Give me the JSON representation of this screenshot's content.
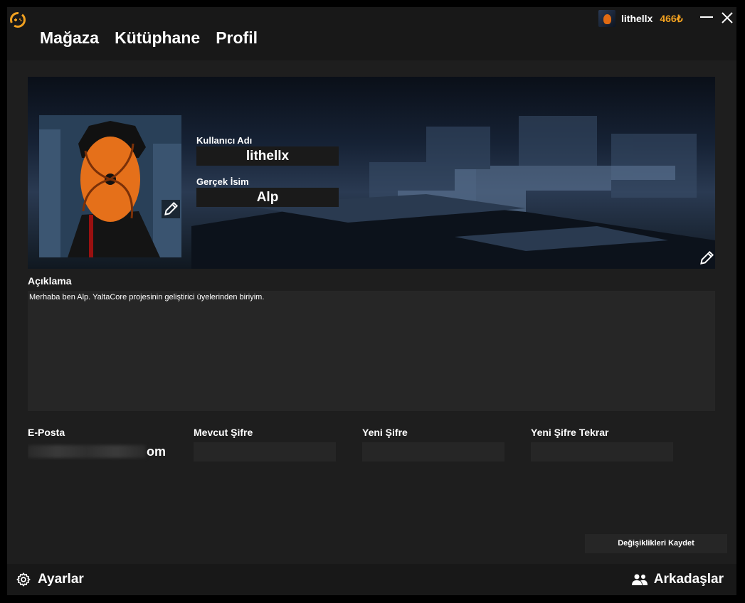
{
  "nav": {
    "items": [
      {
        "label": "Mağaza"
      },
      {
        "label": "Kütüphane"
      },
      {
        "label": "Profil"
      }
    ]
  },
  "user": {
    "name": "lithellx",
    "balance": "466₺"
  },
  "profile": {
    "username_label": "Kullanıcı Adı",
    "username_value": "lithellx",
    "realname_label": "Gerçek İsim",
    "realname_value": "Alp",
    "description_label": "Açıklama",
    "description_value": "Merhaba ben Alp. YaltaCore projesinin geliştirici üyelerinden biriyim."
  },
  "account": {
    "email_label": "E-Posta",
    "email_visible_suffix": "om",
    "current_password_label": "Mevcut Şifre",
    "new_password_label": "Yeni Şifre",
    "new_password_repeat_label": "Yeni Şifre Tekrar"
  },
  "actions": {
    "save_label": "Değişiklikleri Kaydet"
  },
  "footer": {
    "settings_label": "Ayarlar",
    "friends_label": "Arkadaşlar"
  },
  "colors": {
    "accent": "#f0a020",
    "window_bg": "#1e1e1e",
    "bar_bg": "#181818",
    "field_bg": "#262626"
  },
  "icons": [
    "app-logo-icon",
    "minimize-icon",
    "close-icon",
    "pencil-icon",
    "gear-icon",
    "friends-icon"
  ]
}
